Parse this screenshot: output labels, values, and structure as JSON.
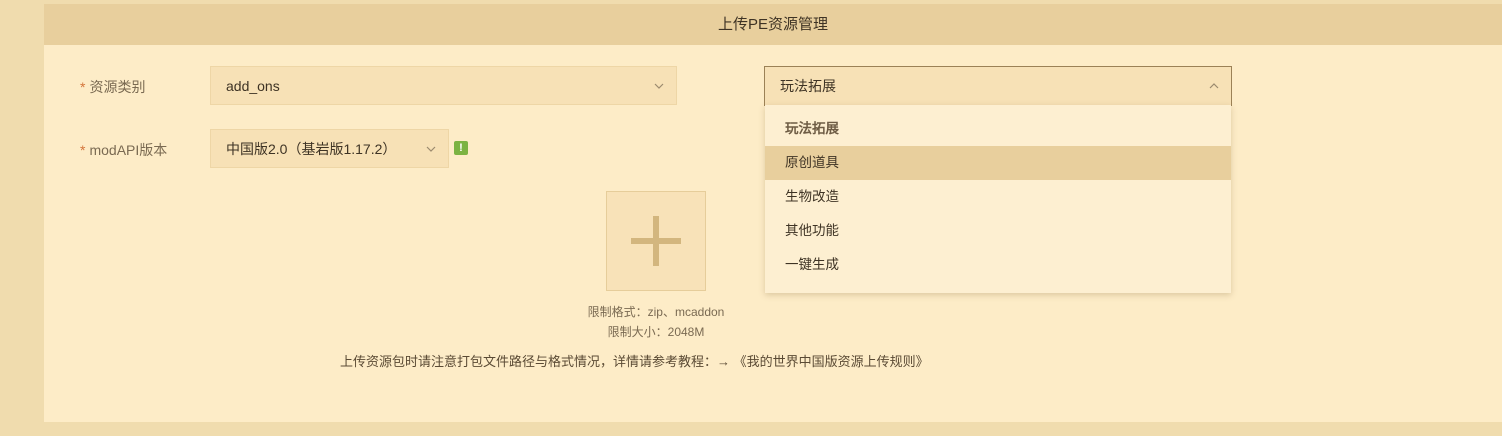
{
  "header": {
    "title": "上传PE资源管理"
  },
  "form": {
    "resource_type": {
      "required_mark": "*",
      "label": "资源类别",
      "value": "add_ons"
    },
    "sub_category": {
      "value": "玩法拓展",
      "options": [
        "玩法拓展",
        "原创道具",
        "生物改造",
        "其他功能",
        "一键生成"
      ],
      "selected_index": 0,
      "hover_index": 1
    },
    "mod_api": {
      "required_mark": "*",
      "label": "modAPI版本",
      "value": "中国版2.0（基岩版1.17.2）",
      "info_icon": "!"
    }
  },
  "upload": {
    "icon": "plus-icon",
    "format_hint": "限制格式：zip、mcaddon",
    "size_hint": "限制大小：2048M"
  },
  "note": {
    "text": "上传资源包时请注意打包文件路径与格式情况，详情请参考教程：→",
    "link": "《我的世界中国版资源上传规则》"
  },
  "colors": {
    "page_bg": "#f0dcae",
    "panel_bg": "#fdecc7",
    "header_bg": "#e8cf9d",
    "required": "#d3743a",
    "info_icon": "#7cb342"
  }
}
